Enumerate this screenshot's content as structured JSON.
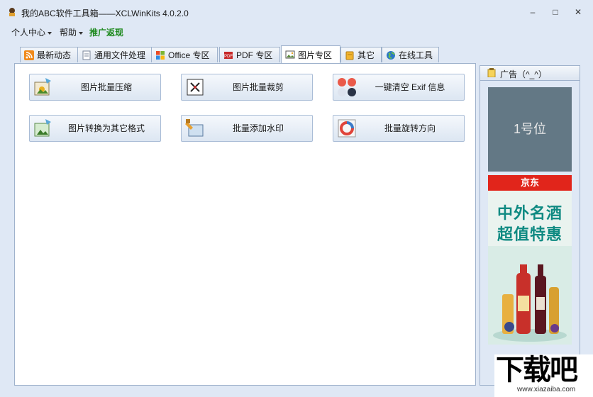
{
  "window": {
    "title": "我的ABC软件工具箱——XCLWinKits  4.0.2.0",
    "controls": {
      "minimize": "–",
      "maximize": "□",
      "close": "✕"
    }
  },
  "menu": {
    "items": [
      "个人中心",
      "帮助"
    ],
    "promo": "推广返现"
  },
  "tabs": [
    {
      "label": "最新动态",
      "icon": "rss-icon"
    },
    {
      "label": "通用文件处理",
      "icon": "file-icon"
    },
    {
      "label": "Office 专区",
      "icon": "office-icon"
    },
    {
      "label": "PDF 专区",
      "icon": "pdf-icon"
    },
    {
      "label": "图片专区",
      "icon": "image-icon",
      "active": true
    },
    {
      "label": "其它",
      "icon": "folder-icon"
    },
    {
      "label": "在线工具",
      "icon": "globe-icon"
    }
  ],
  "tools": [
    {
      "label": "图片批量压缩",
      "icon": "image-compress-icon"
    },
    {
      "label": "图片批量裁剪",
      "icon": "image-crop-icon"
    },
    {
      "label": "一键清空 Exif 信息",
      "icon": "exif-clear-icon"
    },
    {
      "label": "图片转换为其它格式",
      "icon": "image-convert-icon"
    },
    {
      "label": "批量添加水印",
      "icon": "watermark-icon"
    },
    {
      "label": "批量旋转方向",
      "icon": "rotate-icon"
    }
  ],
  "ad": {
    "header": "广告（^_^）",
    "slot1": "1号位",
    "jd_brand": "京东",
    "jd_line1": "中外名酒",
    "jd_line2": "超值特惠"
  },
  "watermark": {
    "big": "下载吧",
    "small": "www.xiazaiba.com"
  },
  "colors": {
    "accent": "#9fb2cc",
    "background": "#dfe8f5",
    "promo": "#1f8a1f",
    "jd_red": "#e1251b"
  }
}
